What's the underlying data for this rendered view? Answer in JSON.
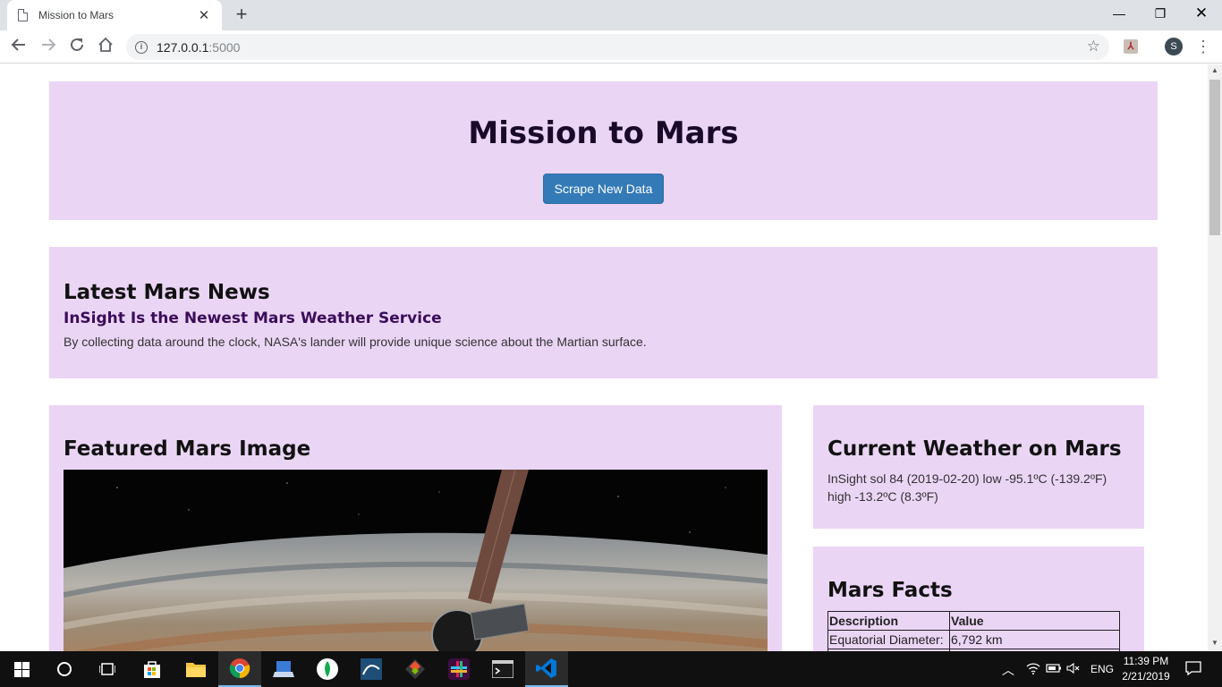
{
  "browser": {
    "tab_title": "Mission to Mars",
    "tab_close": "✕",
    "new_tab": "+",
    "url_host": "127.0.0.1",
    "url_port": ":5000",
    "profile_initial": "S",
    "window_controls": {
      "minimize": "—",
      "restore": "❐",
      "close": "✕"
    }
  },
  "page": {
    "title": "Mission to Mars",
    "scrape_button": "Scrape New Data",
    "news": {
      "heading": "Latest Mars News",
      "title": "InSight Is the Newest Mars Weather Service",
      "paragraph": "By collecting data around the clock, NASA's lander will provide unique science about the Martian surface."
    },
    "featured": {
      "heading": "Featured Mars Image"
    },
    "weather": {
      "heading": "Current Weather on Mars",
      "text": "InSight sol 84 (2019-02-20) low -95.1ºC (-139.2ºF) high -13.2ºC (8.3ºF)"
    },
    "facts": {
      "heading": "Mars Facts",
      "columns": [
        "Description",
        "Value"
      ],
      "rows": [
        [
          "Equatorial Diameter:",
          "6,792 km"
        ],
        [
          "",
          ""
        ]
      ]
    }
  },
  "taskbar": {
    "language": "ENG",
    "time": "11:39 PM",
    "date": "2/21/2019",
    "icons": [
      "start-icon",
      "search-icon",
      "task-view-icon",
      "store-icon",
      "file-explorer-icon",
      "chrome-icon",
      "python-install-icon",
      "mongodb-icon",
      "mysql-workbench-icon",
      "git-icon",
      "slack-icon",
      "terminal-icon",
      "vscode-icon"
    ]
  }
}
